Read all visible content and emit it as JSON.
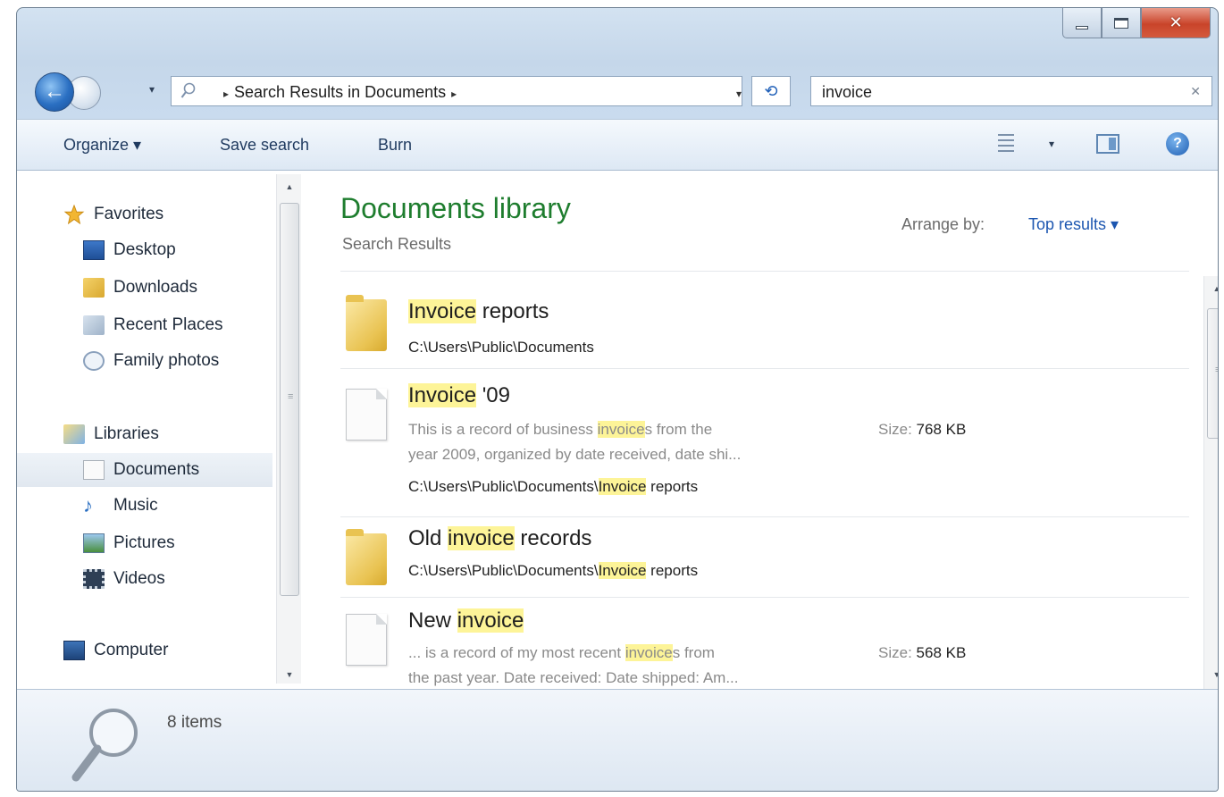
{
  "window": {
    "caption": {
      "close_glyph": "✕"
    }
  },
  "address_bar": {
    "location": "Search Results in Documents",
    "separator": "▸",
    "dropdown": "▾"
  },
  "search": {
    "value": "invoice",
    "clear": "✕"
  },
  "command_bar": {
    "organize": "Organize ▾",
    "save_search": "Save search",
    "burn": "Burn",
    "help": "?"
  },
  "nav_pane": {
    "favorites": {
      "header": "Favorites",
      "items": [
        "Desktop",
        "Downloads",
        "Recent Places",
        "Family photos"
      ]
    },
    "libraries": {
      "header": "Libraries",
      "items": [
        "Documents",
        "Music",
        "Pictures",
        "Videos"
      ],
      "selected": "Documents"
    },
    "computer": "Computer"
  },
  "content": {
    "title": "Documents library",
    "subtitle": "Search Results",
    "arrange_label": "Arrange by:",
    "arrange_value": "Top results ▾",
    "results": [
      {
        "type": "folder",
        "title_pre": "",
        "title_hl": "Invoice",
        "title_post": " reports",
        "path_pre": "C:\\Users\\Public\\Documents",
        "path_hl": "",
        "path_post": ""
      },
      {
        "type": "document",
        "title_pre": "",
        "title_hl": "Invoice",
        "title_post": " '09",
        "snippet_1_pre": "This is a record of business ",
        "snippet_1_hl": "invoice",
        "snippet_1_post": "s from the",
        "snippet_2": "year 2009, organized by date received, date shi...",
        "path_pre": "C:\\Users\\Public\\Documents\\",
        "path_hl": "Invoice",
        "path_post": " reports",
        "size_label": "Size:",
        "size_value": "768 KB"
      },
      {
        "type": "folder",
        "title_pre": "Old ",
        "title_hl": "invoice",
        "title_post": " records",
        "path_pre": "C:\\Users\\Public\\Documents\\",
        "path_hl": "Invoice",
        "path_post": " reports"
      },
      {
        "type": "document",
        "title_pre": "New ",
        "title_hl": "invoice",
        "title_post": "",
        "snippet_1_pre": "... is a record of my most recent ",
        "snippet_1_hl": "invoice",
        "snippet_1_post": "s from",
        "snippet_2": "the past year. Date received: Date shipped: Am...",
        "size_label": "Size:",
        "size_value": "568 KB"
      }
    ]
  },
  "details": {
    "count": "8 items"
  },
  "scroll": {
    "up": "▲",
    "down": "▼",
    "grip": "≡"
  },
  "colors": {
    "library_title": "#1e7d2e",
    "link": "#1c56b0",
    "highlight": "#fdf498"
  }
}
